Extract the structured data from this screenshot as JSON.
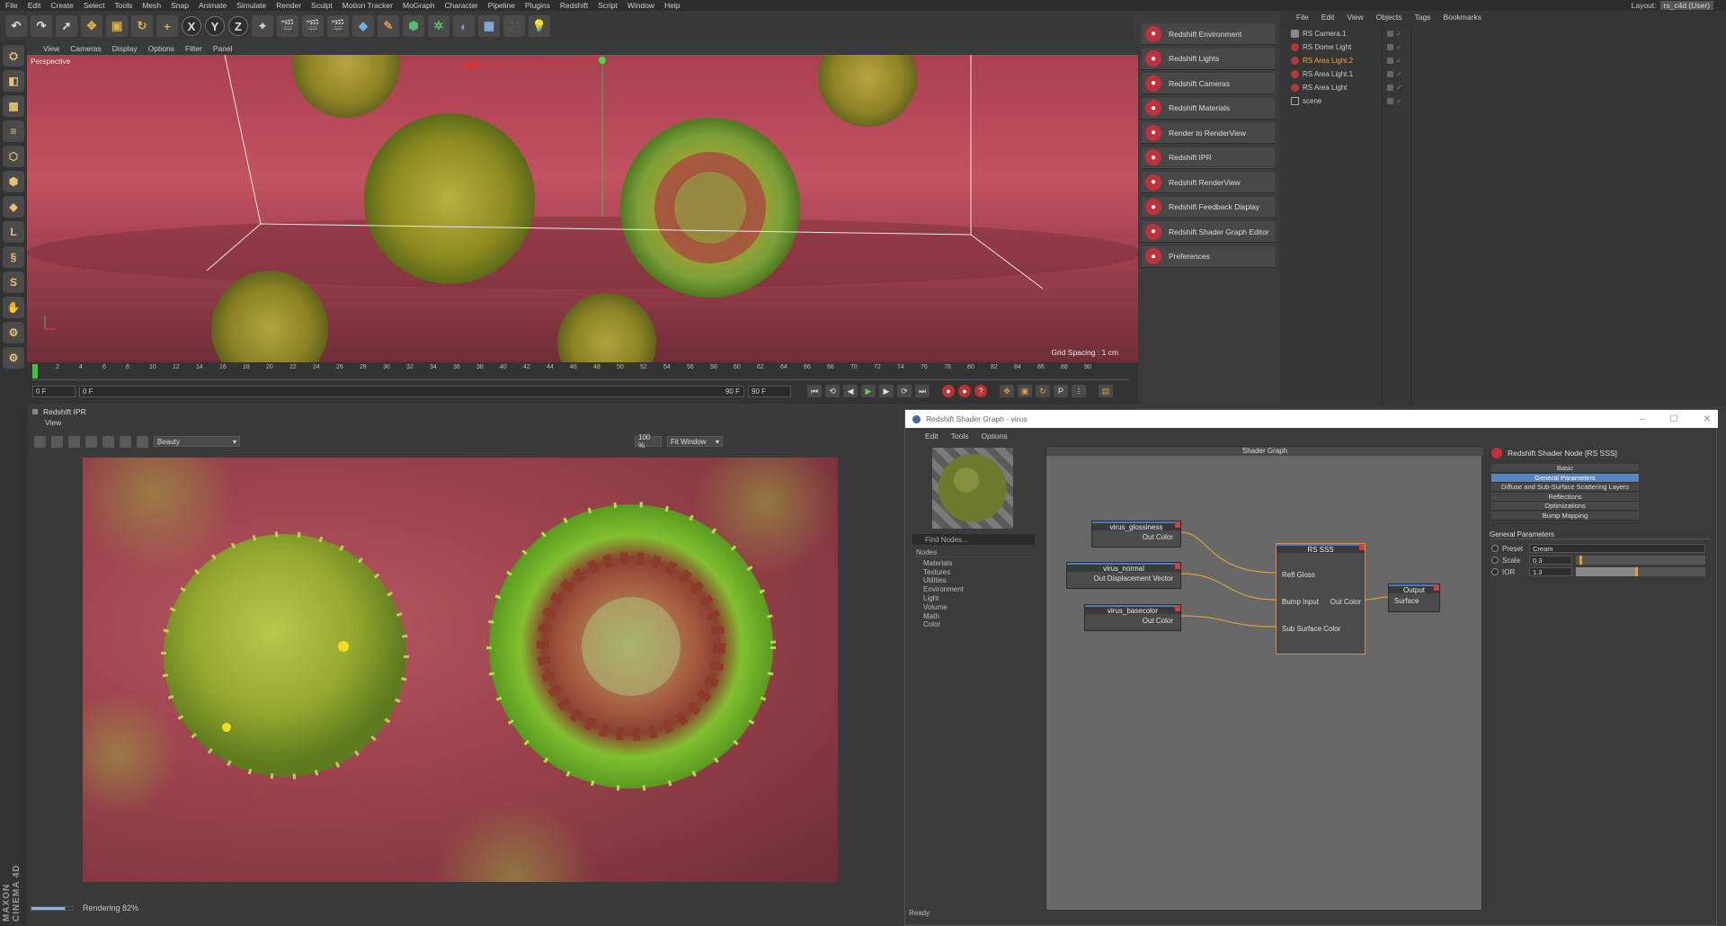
{
  "menubar": [
    "File",
    "Edit",
    "Create",
    "Select",
    "Tools",
    "Mesh",
    "Snap",
    "Animate",
    "Simulate",
    "Render",
    "Sculpt",
    "Motion Tracker",
    "MoGraph",
    "Character",
    "Pipeline",
    "Plugins",
    "Redshift",
    "Script",
    "Window",
    "Help"
  ],
  "layout": {
    "label": "Layout:",
    "value": "rs_c4d (User)"
  },
  "viewport": {
    "menu": [
      "View",
      "Cameras",
      "Display",
      "Options",
      "Filter",
      "Panel"
    ],
    "camera_label": "Perspective",
    "grid_spacing": "Grid Spacing : 1 cm"
  },
  "timeline": {
    "ticks": [
      "0",
      "2",
      "4",
      "6",
      "8",
      "10",
      "12",
      "14",
      "16",
      "18",
      "20",
      "22",
      "24",
      "26",
      "28",
      "30",
      "32",
      "34",
      "36",
      "38",
      "40",
      "42",
      "44",
      "46",
      "48",
      "50",
      "52",
      "54",
      "56",
      "58",
      "60",
      "62",
      "64",
      "66",
      "68",
      "70",
      "72",
      "74",
      "76",
      "78",
      "80",
      "82",
      "84",
      "86",
      "88",
      "90"
    ],
    "start": "0 F",
    "current": "0 F",
    "end_a": "90 F",
    "end_b": "90 F",
    "frame": "0 F"
  },
  "redshift_menu": [
    "Redshift Environment",
    "Redshift Lights",
    "Redshift Cameras",
    "Redshift Materials",
    "Render to RenderView",
    "Redshift IPR",
    "Redshift RenderView",
    "Redshift Feedback Display",
    "Redshift Shader Graph Editor",
    "Preferences"
  ],
  "objects": {
    "menu": [
      "File",
      "Edit",
      "View",
      "Objects",
      "Tags",
      "Bookmarks"
    ],
    "items": [
      {
        "name": "RS Camera.1",
        "active": false,
        "icon": "camera-icon"
      },
      {
        "name": "RS Dome Light",
        "active": false,
        "icon": "light-icon"
      },
      {
        "name": "RS Area Light.2",
        "active": true,
        "icon": "light-icon"
      },
      {
        "name": "RS Area Light.1",
        "active": false,
        "icon": "light-icon"
      },
      {
        "name": "RS Area Light",
        "active": false,
        "icon": "light-icon"
      },
      {
        "name": "scene",
        "active": false,
        "icon": "null-icon"
      }
    ]
  },
  "ipr": {
    "title": "Redshift IPR",
    "view_menu": "View",
    "aov": "Beauty",
    "zoom": "100 %",
    "fit": "Fit Window",
    "status": "Rendering 82%",
    "progress": 0.82
  },
  "shader_graph": {
    "title": "Redshift Shader Graph - virus",
    "menu": [
      "Edit",
      "Tools",
      "Options"
    ],
    "find_placeholder": "Find Nodes...",
    "nodes_header": "Nodes",
    "categories": [
      "Materials",
      "Textures",
      "Utilities",
      "Environment",
      "Light",
      "Volume",
      "Math",
      "Color"
    ],
    "canvas_title": "Shader Graph",
    "nodes": {
      "glossiness": {
        "title": "virus_glossiness",
        "out": "Out Color"
      },
      "normal": {
        "title": "virus_normal",
        "out": "Out Displacement Vector"
      },
      "basecolor": {
        "title": "virus_basecolor",
        "out": "Out Color"
      },
      "sss": {
        "title": "RS SSS",
        "in1": "Refl Gloss",
        "in2": "Bump Input",
        "out": "Out Color",
        "in3": "Sub Surface Color"
      },
      "output": {
        "title": "Output",
        "in": "Surface"
      }
    },
    "status": "Ready"
  },
  "properties": {
    "title": "Redshift Shader Node [RS SSS]",
    "tabs": [
      "Basic",
      "General Parameters",
      "Diffuse and Sub-Surface Scattering Layers",
      "Reflections",
      "Optimizations",
      "Bump Mapping"
    ],
    "active_tab": "General Parameters",
    "section": "General Parameters",
    "preset_label": "Preset",
    "preset_value": "Cream",
    "scale_label": "Scale",
    "scale_value": "0.3",
    "ior_label": "IOR",
    "ior_value": "1.3"
  },
  "brand": "MAXON CINEMA 4D"
}
